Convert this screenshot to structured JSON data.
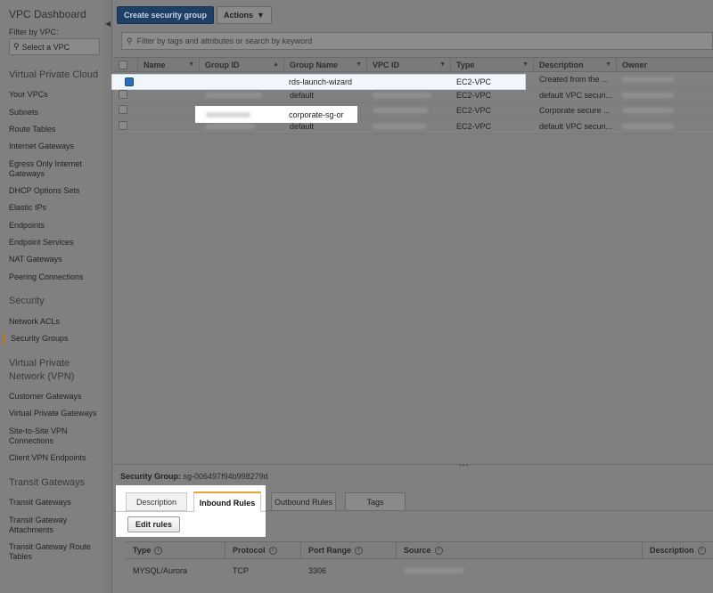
{
  "sidebar": {
    "title": "VPC Dashboard",
    "filter_label": "Filter by VPC:",
    "vpc_placeholder": "Select a VPC",
    "sections": [
      {
        "label": "Virtual Private Cloud"
      },
      {
        "label": "Security"
      },
      {
        "label": "Virtual Private Network (VPN)"
      },
      {
        "label": "Transit Gateways"
      }
    ],
    "items": [
      {
        "label": "Your VPCs"
      },
      {
        "label": "Subnets"
      },
      {
        "label": "Route Tables"
      },
      {
        "label": "Internet Gateways"
      },
      {
        "label": "Egress Only Internet Gateways"
      },
      {
        "label": "DHCP Options Sets"
      },
      {
        "label": "Elastic IPs"
      },
      {
        "label": "Endpoints"
      },
      {
        "label": "Endpoint Services"
      },
      {
        "label": "NAT Gateways"
      },
      {
        "label": "Peering Connections"
      },
      {
        "label": "Network ACLs"
      },
      {
        "label": "Security Groups"
      },
      {
        "label": "Customer Gateways"
      },
      {
        "label": "Virtual Private Gateways"
      },
      {
        "label": "Site-to-Site VPN Connections"
      },
      {
        "label": "Client VPN Endpoints"
      },
      {
        "label": "Transit Gateways"
      },
      {
        "label": "Transit Gateway Attachments"
      },
      {
        "label": "Transit Gateway Route Tables"
      }
    ]
  },
  "toolbar": {
    "create_label": "Create security group",
    "actions_label": "Actions"
  },
  "search": {
    "placeholder": "Filter by tags and attributes or search by keyword"
  },
  "table": {
    "columns": [
      "Name",
      "Group ID",
      "Group Name",
      "VPC ID",
      "Type",
      "Description",
      "Owner"
    ],
    "rows": [
      {
        "group_name": "rds-launch-wizard",
        "type": "EC2-VPC",
        "description": "Created from the ...",
        "selected": true
      },
      {
        "group_name": "default",
        "type": "EC2-VPC",
        "description": "default VPC securi...",
        "selected": false
      },
      {
        "group_name": "corporate-sg-or",
        "type": "EC2-VPC",
        "description": "Corporate secure ...",
        "selected": false
      },
      {
        "group_name": "default",
        "type": "EC2-VPC",
        "description": "default VPC securi...",
        "selected": false
      }
    ]
  },
  "detail": {
    "sg_label": "Security Group:",
    "sg_id": "sg-006497f94b998279d",
    "tabs": [
      "Description",
      "Inbound Rules",
      "Outbound Rules",
      "Tags"
    ],
    "active_tab": "Inbound Rules",
    "edit_rules_label": "Edit rules",
    "rules_columns": [
      "Type",
      "Protocol",
      "Port Range",
      "Source",
      "Description"
    ],
    "rules_rows": [
      {
        "type": "MYSQL/Aurora",
        "protocol": "TCP",
        "port_range": "3306",
        "source": "",
        "description": ""
      }
    ]
  },
  "colors": {
    "primary_button": "#1e3f66",
    "active_tab_accent": "#e8a33a",
    "selected_checkbox": "#2c6fb8",
    "active_nav_marker": "#c07a10"
  }
}
